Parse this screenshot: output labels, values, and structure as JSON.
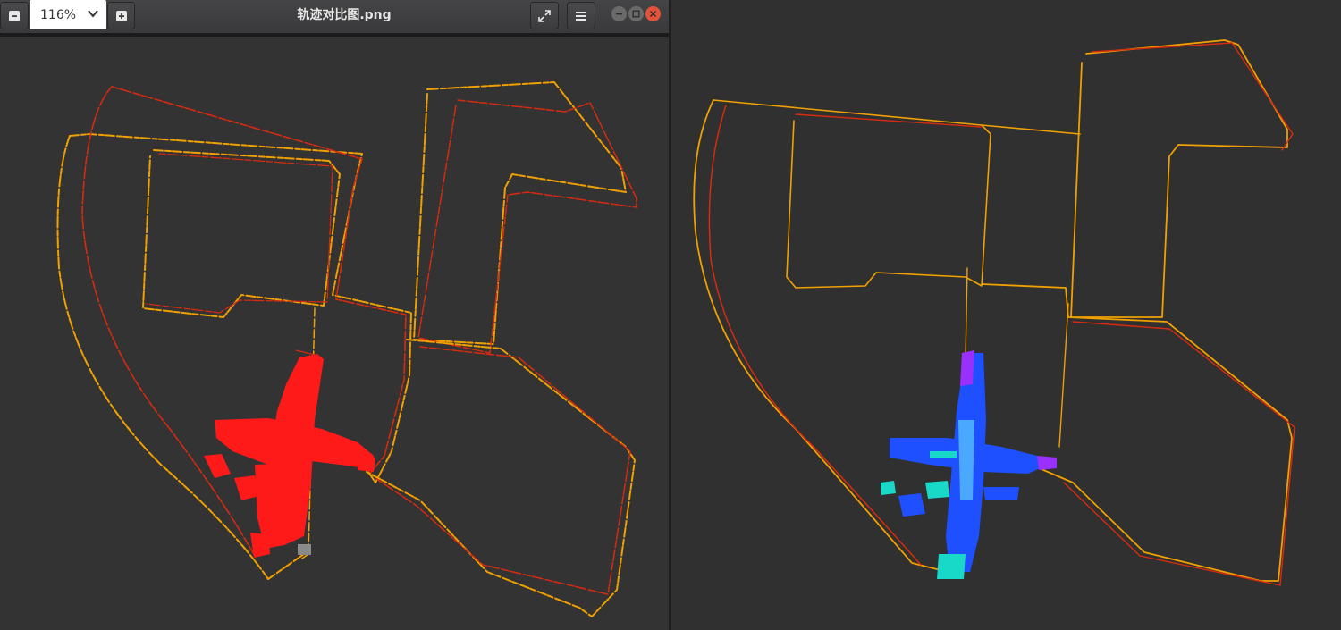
{
  "toolbar": {
    "zoom_value": "116%",
    "zoom_out_icon": "minus-icon",
    "zoom_in_icon": "plus-icon",
    "fullscreen_icon": "fullscreen-icon",
    "menu_icon": "hamburger-menu-icon"
  },
  "window": {
    "title": "轨迹对比图.png",
    "controls": [
      "minimize-icon",
      "maximize-icon",
      "close-icon"
    ]
  },
  "colors": {
    "accent_close": "#e2533a",
    "trajectory_orange": "#f0a000",
    "trajectory_red": "#d82a10",
    "cloud_red": "#ff1a1a",
    "cloud_blue": "#1e50ff",
    "cloud_cyan": "#18d8c8",
    "cloud_violet": "#9a30ff"
  }
}
